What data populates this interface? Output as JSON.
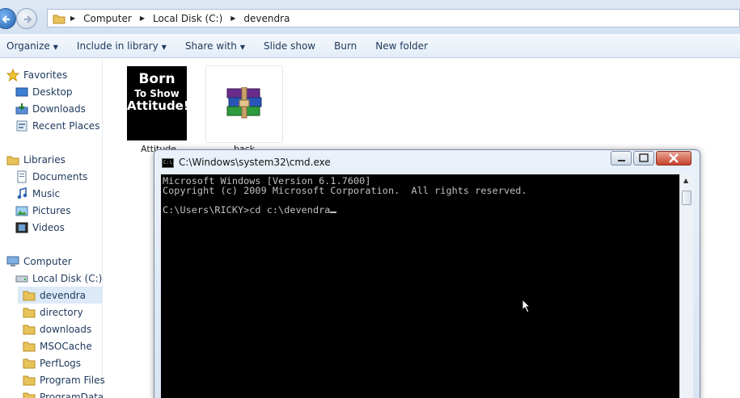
{
  "address": {
    "crumbs": [
      "Computer",
      "Local Disk (C:)",
      "devendra"
    ]
  },
  "toolbar": {
    "organize": "Organize",
    "include": "Include in library",
    "share": "Share with",
    "slideshow": "Slide show",
    "burn": "Burn",
    "newfolder": "New folder"
  },
  "sidebar": {
    "favorites": "Favorites",
    "desktop": "Desktop",
    "downloads": "Downloads",
    "recent": "Recent Places",
    "libraries": "Libraries",
    "documents": "Documents",
    "music": "Music",
    "pictures": "Pictures",
    "videos": "Videos",
    "computer": "Computer",
    "localdisk": "Local Disk (C:)",
    "folders": [
      "devendra",
      "directory",
      "downloads",
      "MSOCache",
      "PerfLogs",
      "Program Files",
      "ProgramData"
    ]
  },
  "files": {
    "attitude_label": "Attitude",
    "attitude_lines": [
      "Born",
      "To Show",
      "Attitude!"
    ],
    "back_label": "back"
  },
  "cmd": {
    "title": "C:\\Windows\\system32\\cmd.exe",
    "icon_text": "C:\\.",
    "lines": [
      "Microsoft Windows [Version 6.1.7600]",
      "Copyright (c) 2009 Microsoft Corporation.  All rights reserved.",
      "C:\\Users\\RICKY>cd c:\\devendra"
    ]
  },
  "colors": {
    "accent": "#1e395b",
    "console_bg": "#000000",
    "console_fg": "#c0c0c0",
    "selection": "#dce9f8"
  }
}
